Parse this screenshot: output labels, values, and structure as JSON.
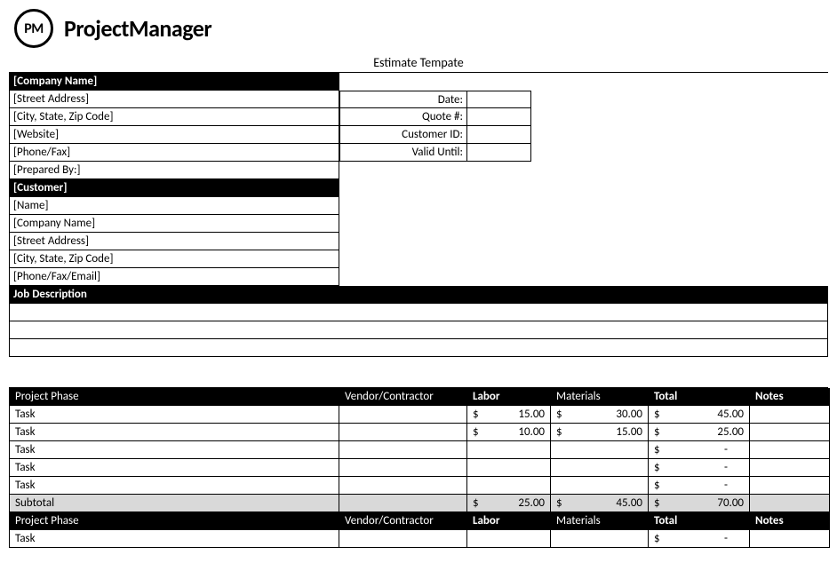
{
  "brand": {
    "badge": "PM",
    "name": "ProjectManager"
  },
  "title": "Estimate Tempate",
  "company_header": "[Company Name]",
  "company_fields": [
    "[Street Address]",
    "[City, State, Zip Code]",
    "[Website]",
    "[Phone/Fax]",
    "[Prepared By:]"
  ],
  "meta_labels": [
    "Date:",
    "Quote #:",
    "Customer ID:",
    "Valid Until:"
  ],
  "meta_values": [
    "",
    "",
    "",
    ""
  ],
  "customer_header": "[Customer]",
  "customer_fields": [
    "[Name]",
    "[Company Name]",
    "[Street Address]",
    "[City, State, Zip Code]",
    "[Phone/Fax/Email]"
  ],
  "job_description_header": "Job Description",
  "job_description_lines": [
    "",
    "",
    ""
  ],
  "columns": {
    "phase": "Project Phase",
    "vendor": "Vendor/Contractor",
    "labor": "Labor",
    "materials": "Materials",
    "total": "Total",
    "notes": "Notes"
  },
  "currency": "$",
  "phase1": {
    "rows": [
      {
        "task": "Task",
        "vendor": "",
        "labor": "15.00",
        "materials": "30.00",
        "total": "45.00",
        "notes": ""
      },
      {
        "task": "Task",
        "vendor": "",
        "labor": "10.00",
        "materials": "15.00",
        "total": "25.00",
        "notes": ""
      },
      {
        "task": "Task",
        "vendor": "",
        "labor": "",
        "materials": "",
        "total": "-",
        "notes": ""
      },
      {
        "task": "Task",
        "vendor": "",
        "labor": "",
        "materials": "",
        "total": "-",
        "notes": ""
      },
      {
        "task": "Task",
        "vendor": "",
        "labor": "",
        "materials": "",
        "total": "-",
        "notes": ""
      }
    ],
    "subtotal_label": "Subtotal",
    "subtotal": {
      "labor": "25.00",
      "materials": "45.00",
      "total": "70.00"
    }
  },
  "phase2": {
    "rows": [
      {
        "task": "Task",
        "vendor": "",
        "labor": "",
        "materials": "",
        "total": "-",
        "notes": ""
      }
    ]
  }
}
